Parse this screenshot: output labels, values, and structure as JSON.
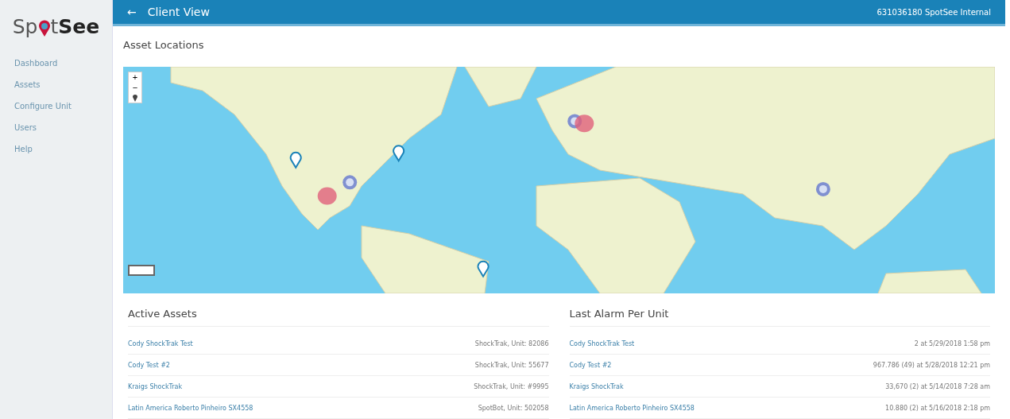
{
  "sidebar": {
    "logo": {
      "part_1": "Sp",
      "part_2": "t",
      "part_3": "See"
    },
    "items": [
      {
        "label": "Dashboard",
        "selected": false
      },
      {
        "label": "Assets",
        "selected": false
      },
      {
        "label": "Configure Unit",
        "selected": false
      },
      {
        "label": "Users",
        "selected": false
      },
      {
        "label": "Help",
        "selected": false
      }
    ]
  },
  "header": {
    "back": "←",
    "title": "Client View",
    "account": "631036180 SpotSee Internal"
  },
  "map_section": {
    "title": "Asset Locations",
    "zoom_in": "+",
    "zoom_out": "−"
  },
  "active_assets": {
    "title": "Active Assets",
    "rows": [
      {
        "name": "Cody ShockTrak Test",
        "detail": "ShockTrak, Unit: 82086"
      },
      {
        "name": "Cody Test #2",
        "detail": "ShockTrak, Unit: 55677"
      },
      {
        "name": "Kraigs ShockTrak",
        "detail": "ShockTrak, Unit: #9995"
      },
      {
        "name": "Latin America Roberto Pinheiro SX4558",
        "detail": "SpotBot, Unit: 502058"
      }
    ]
  },
  "last_alarm": {
    "title": "Last Alarm Per Unit",
    "rows": [
      {
        "name": "Cody ShockTrak Test",
        "detail": "2 at 5/29/2018 1:58 pm"
      },
      {
        "name": "Cody Test #2",
        "detail": "967.786 (49) at 5/28/2018 12:21 pm"
      },
      {
        "name": "Kraigs ShockTrak",
        "detail": "33,670 (2) at 5/14/2018 7:28 am"
      },
      {
        "name": "Latin America Roberto Pinheiro SX4558",
        "detail": "10.880 (2) at 5/16/2018 2:18 pm"
      }
    ]
  }
}
